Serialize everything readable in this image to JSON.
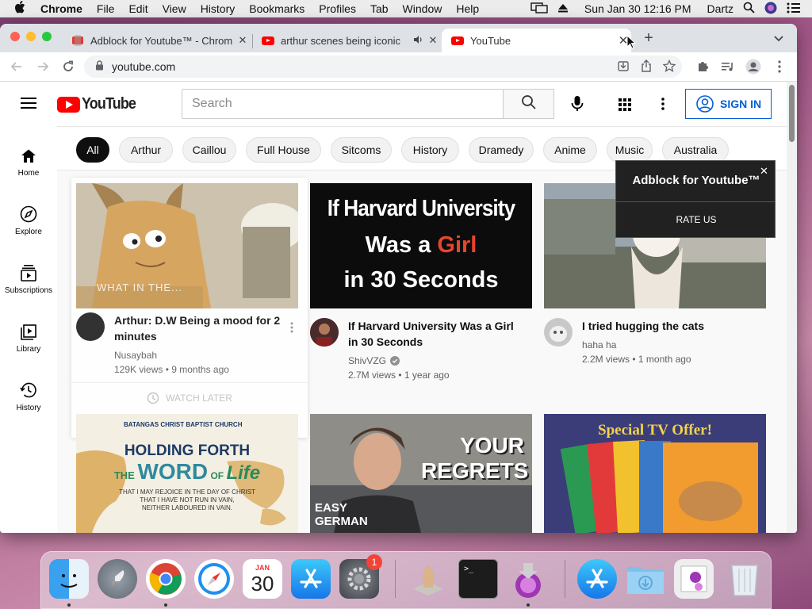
{
  "menubar": {
    "app": "Chrome",
    "items": [
      "File",
      "Edit",
      "View",
      "History",
      "Bookmarks",
      "Profiles",
      "Tab",
      "Window",
      "Help"
    ],
    "clock": "Sun Jan 30  12:16 PM",
    "user": "Dartz"
  },
  "browser": {
    "tabs": [
      {
        "title": "Adblock for Youtube™ - Chrom"
      },
      {
        "title": "arthur scenes being iconic"
      },
      {
        "title": "YouTube"
      }
    ],
    "url": "youtube.com"
  },
  "youtube": {
    "logo_text": "YouTube",
    "search_placeholder": "Search",
    "sign_in": "SIGN IN",
    "nav": [
      {
        "label": "Home",
        "icon": "home-icon"
      },
      {
        "label": "Explore",
        "icon": "compass-icon"
      },
      {
        "label": "Subscriptions",
        "icon": "subscriptions-icon"
      },
      {
        "label": "Library",
        "icon": "library-icon"
      },
      {
        "label": "History",
        "icon": "history-icon"
      }
    ],
    "chips": [
      "All",
      "Arthur",
      "Caillou",
      "Full House",
      "Sitcoms",
      "History",
      "Dramedy",
      "Anime",
      "Music",
      "Australia"
    ],
    "videos": [
      {
        "title": "Arthur: D.W Being a mood for 2 minutes",
        "channel": "Nusaybah",
        "stats": "129K views • 9 months ago",
        "thumb_caption": "WHAT IN THE...",
        "hover_action": "WATCH LATER"
      },
      {
        "title": "If Harvard University Was a Girl in 30 Seconds",
        "channel": "ShivVZG",
        "stats": "2.7M views • 1 year ago",
        "thumb_line1": "If Harvard University",
        "thumb_line2a": "Was a ",
        "thumb_line2b": "Girl",
        "thumb_line3": "in 30 Seconds"
      },
      {
        "title": "I tried hugging the cats",
        "channel": "haha ha",
        "stats": "2.2M views • 1 month ago"
      },
      {
        "thumb_church": "BATANGAS CHRIST BAPTIST CHURCH",
        "thumb_line1": "HOLDING FORTH",
        "thumb_line2a": "THE ",
        "thumb_line2b": "WORD",
        "thumb_line2c": " OF ",
        "thumb_line2d": "Life",
        "thumb_verse1": "THAT I MAY REJOICE IN THE DAY OF CHRIST",
        "thumb_verse2": "THAT I HAVE NOT RUN IN VAIN,",
        "thumb_verse3": "NEITHER LABOURED IN VAIN."
      },
      {
        "thumb_line1": "YOUR",
        "thumb_line2": "REGRETS",
        "thumb_line3": "EASY",
        "thumb_line4": "GERMAN"
      },
      {
        "thumb_line1": "Special TV Offer!"
      }
    ]
  },
  "adblock_popup": {
    "title": "Adblock for Youtube™",
    "rate": "RATE US"
  },
  "dock": {
    "calendar_month": "JAN",
    "calendar_day": "30",
    "settings_badge": "1"
  },
  "colors": {
    "yt_red": "#ff0000",
    "signin_blue": "#065fd4",
    "harvard_girl_red": "#e8452c"
  }
}
